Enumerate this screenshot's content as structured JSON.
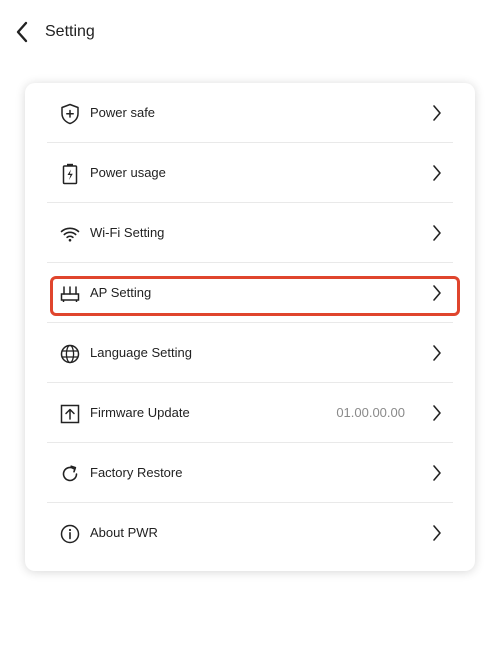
{
  "header": {
    "title": "Setting",
    "back_icon": "chevron-left-icon"
  },
  "settings": {
    "items": [
      {
        "label": "Power safe",
        "icon": "shield-plus-icon",
        "value": ""
      },
      {
        "label": "Power usage",
        "icon": "battery-charge-icon",
        "value": ""
      },
      {
        "label": "Wi-Fi Setting",
        "icon": "wifi-icon",
        "value": ""
      },
      {
        "label": "AP Setting",
        "icon": "router-icon",
        "value": "",
        "highlighted": true
      },
      {
        "label": "Language Setting",
        "icon": "globe-icon",
        "value": ""
      },
      {
        "label": "Firmware Update",
        "icon": "upload-icon",
        "value": "01.00.00.00"
      },
      {
        "label": "Factory Restore",
        "icon": "refresh-icon",
        "value": ""
      },
      {
        "label": "About PWR",
        "icon": "info-icon",
        "value": ""
      }
    ]
  },
  "colors": {
    "highlight": "#e0452d",
    "divider": "#e9e9e9",
    "text": "#222222",
    "muted": "#8a8a8a"
  }
}
